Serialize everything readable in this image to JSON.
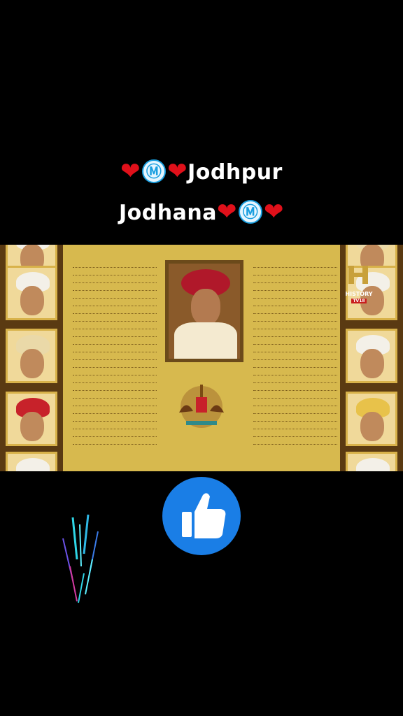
{
  "caption": {
    "line1": {
      "prefix_hearts": "❤",
      "badge": "Ⓜ",
      "text": "Jodhpur"
    },
    "line2": {
      "text": "Jodhana",
      "badge": "Ⓜ"
    }
  },
  "video": {
    "watermark": "HISTORY",
    "watermark_sub": "TV18"
  },
  "colors": {
    "heart": "#e0101a",
    "badge": "#1a9fe0",
    "like_button": "#1a7ee6"
  },
  "icons": [
    "heart-icon",
    "m-badge-icon",
    "thumbs-up-icon",
    "sparkle-icon"
  ]
}
